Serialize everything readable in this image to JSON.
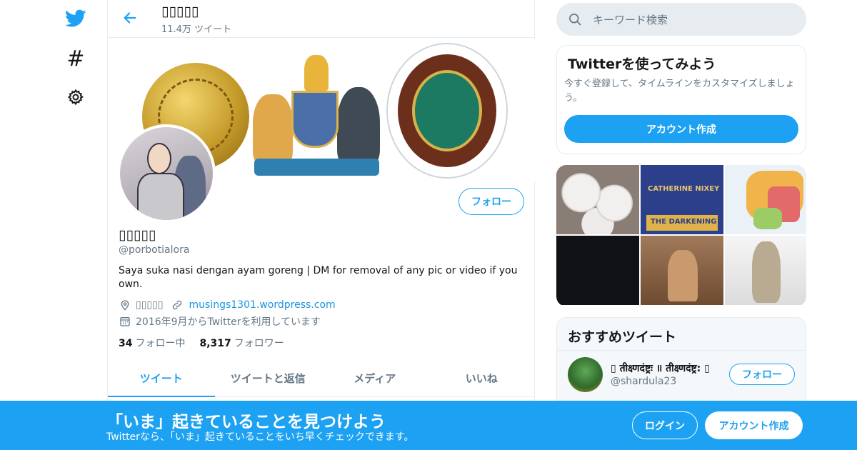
{
  "colors": {
    "brand": "#1da1f2",
    "link": "#1b95e0",
    "text": "#14171a",
    "secondary": "#657786",
    "border": "#e6ecf0"
  },
  "nav": {
    "icons": [
      "twitter-bird-icon",
      "hashtag-icon",
      "gear-icon"
    ]
  },
  "header": {
    "name": "▯▯▯▯▯",
    "tweet_count": "11.4万 ツイート"
  },
  "profile": {
    "name": "▯▯▯▯▯",
    "handle": "@porbotialora",
    "follow_label": "フォロー",
    "bio": "Saya suka nasi dengan ayam goreng | DM for removal of any pic or video if you own.",
    "location": "▯▯▯▯▯",
    "url": "musings1301.wordpress.com",
    "joined": "2016年9月からTwitterを利用しています",
    "following_count": "34",
    "following_label": "フォロー中",
    "followers_count": "8,317",
    "followers_label": "フォロワー"
  },
  "tabs": [
    {
      "label": "ツイート",
      "active": true
    },
    {
      "label": "ツイートと返信",
      "active": false
    },
    {
      "label": "メディア",
      "active": false
    },
    {
      "label": "いいね",
      "active": false
    }
  ],
  "search": {
    "placeholder": "キーワード検索"
  },
  "signup_card": {
    "title": "Twitterを使ってみよう",
    "text": "今すぐ登録して、タイムラインをカスタマイズしましょう。",
    "button": "アカウント作成"
  },
  "media_thumbs": {
    "book_author": "CATHERINE NIXEY",
    "book_title": "THE DARKENING"
  },
  "recommended": {
    "title": "おすすめツイート",
    "name": "▯ तीक्ष्णदंष्ट्रः ॥ तीक्ष्णदंष्ट्र: ▯",
    "handle": "@shardula23",
    "follow_label": "フォロー"
  },
  "bottom_bar": {
    "title": "「いま」起きていることを見つけよう",
    "subtitle": "Twitterなら、「いま」起きていることをいち早くチェックできます。",
    "login": "ログイン",
    "signup": "アカウント作成"
  }
}
